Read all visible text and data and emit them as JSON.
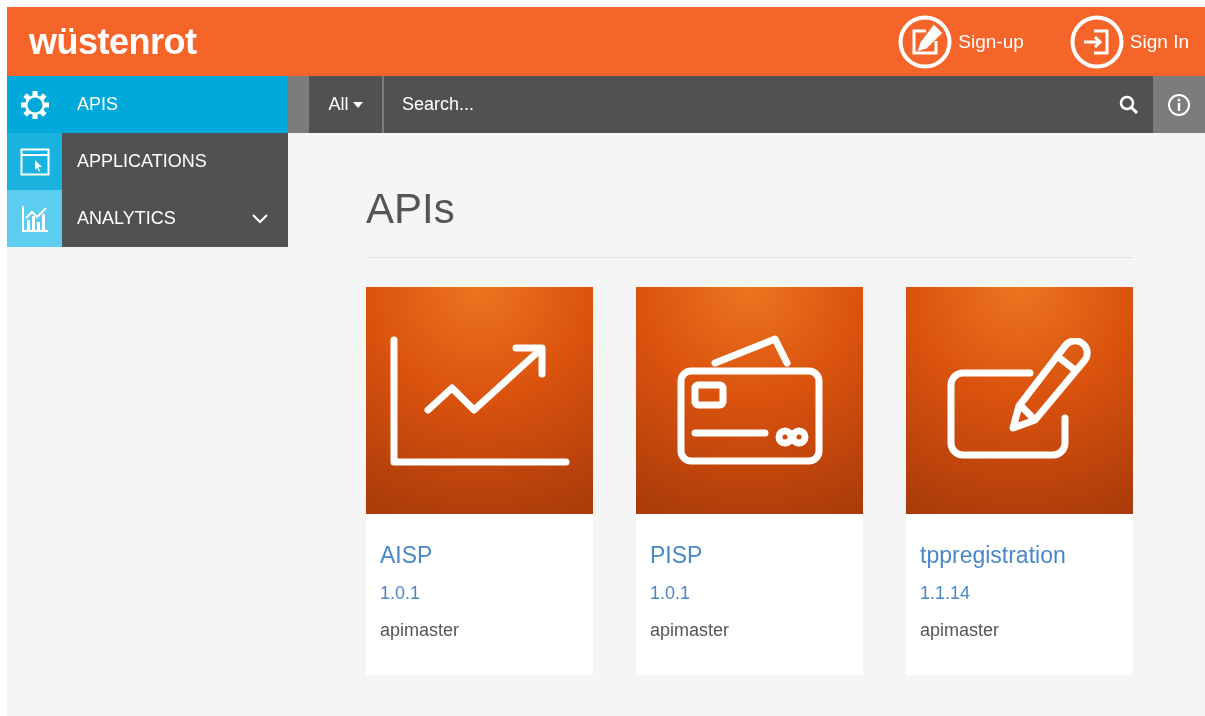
{
  "header": {
    "logo": "wüstenrot",
    "actions": [
      {
        "label": "Sign-up"
      },
      {
        "label": "Sign In"
      }
    ]
  },
  "sidebar": {
    "items": [
      {
        "label": "APIS",
        "selected": true,
        "kind": "link"
      },
      {
        "label": "APPLICATIONS",
        "selected": false,
        "kind": "link"
      },
      {
        "label": "ANALYTICS",
        "selected": false,
        "kind": "group",
        "expanded": false
      }
    ]
  },
  "toolbar": {
    "filter": "All",
    "search": {
      "placeholder": "Search..."
    }
  },
  "content": {
    "title": "APIs",
    "cards": [
      {
        "name": "AISP",
        "version": "1.0.1",
        "author": "apimaster"
      },
      {
        "name": "PISP",
        "version": "1.0.1",
        "author": "apimaster"
      },
      {
        "name": "tppregistration",
        "version": "1.1.14",
        "author": "apimaster"
      }
    ]
  }
}
